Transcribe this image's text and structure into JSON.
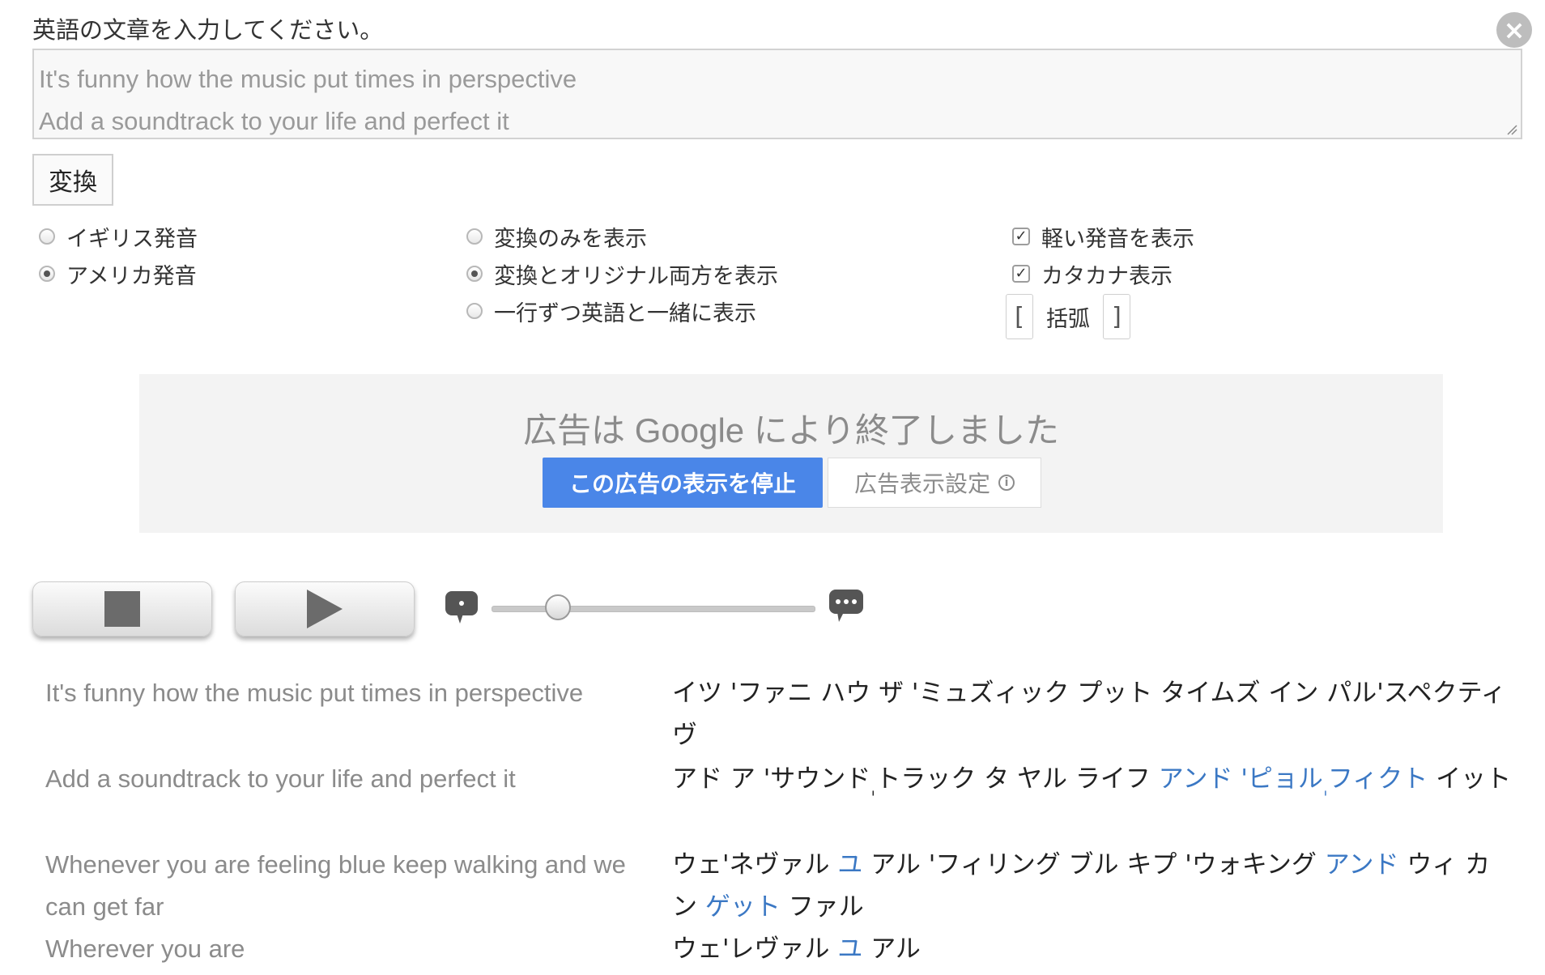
{
  "form": {
    "prompt": "英語の文章を入力してください。",
    "input_lines": [
      "It's funny how the music put times in perspective",
      "Add a soundtrack to your life and perfect it"
    ],
    "convert_label": "変換"
  },
  "options": {
    "accent": [
      {
        "label": "イギリス発音",
        "checked": false
      },
      {
        "label": "アメリカ発音",
        "checked": true
      }
    ],
    "display": [
      {
        "label": "変換のみを表示",
        "checked": false
      },
      {
        "label": "変換とオリジナル両方を表示",
        "checked": true
      },
      {
        "label": "一行ずつ英語と一緒に表示",
        "checked": false
      }
    ],
    "extras": [
      {
        "label": "軽い発音を表示",
        "checked": true
      },
      {
        "label": "カタカナ表示",
        "checked": true
      }
    ],
    "bracket": {
      "open": "[",
      "label": "括弧",
      "close": "]"
    }
  },
  "ad": {
    "title": "広告は Google により終了しました",
    "stop_label": "この広告の表示を停止",
    "settings_label": "広告表示設定",
    "info_glyph": "i"
  },
  "player": {
    "speed_fraction": 0.18
  },
  "lyrics": [
    {
      "en": "It's funny how the music put times in perspective",
      "kana": [
        {
          "t": "イツ 'ファニ ハウ ザ 'ミュズィック プット タイムズ イン パル'スペクティヴ"
        }
      ]
    },
    {
      "en": "Add a soundtrack to your life and perfect it",
      "kana": [
        {
          "t": "アド ア 'サウンド"
        },
        {
          "t": "ˌ",
          "sub": true
        },
        {
          "t": "トラック タ ヤル ライフ "
        },
        {
          "t": "アンド 'ピョル",
          "link": true
        },
        {
          "t": "ˌ",
          "sub": true,
          "link": true
        },
        {
          "t": "フィクト",
          "link": true
        },
        {
          "t": " イット"
        }
      ]
    },
    {
      "en": "Whenever you are feeling blue keep walking and we can get far",
      "kana": [
        {
          "t": "ウェ'ネヴァル "
        },
        {
          "t": "ユ",
          "link": true
        },
        {
          "t": " アル 'フィリング ブル キプ 'ウォキング "
        },
        {
          "t": "アンド",
          "link": true
        },
        {
          "t": " ウィ カン "
        },
        {
          "t": "ゲット",
          "link": true
        },
        {
          "t": " ファル"
        }
      ]
    },
    {
      "en": "Wherever you are",
      "kana": [
        {
          "t": "ウェ'レヴァル "
        },
        {
          "t": "ユ",
          "link": true
        },
        {
          "t": " アル"
        }
      ]
    }
  ]
}
